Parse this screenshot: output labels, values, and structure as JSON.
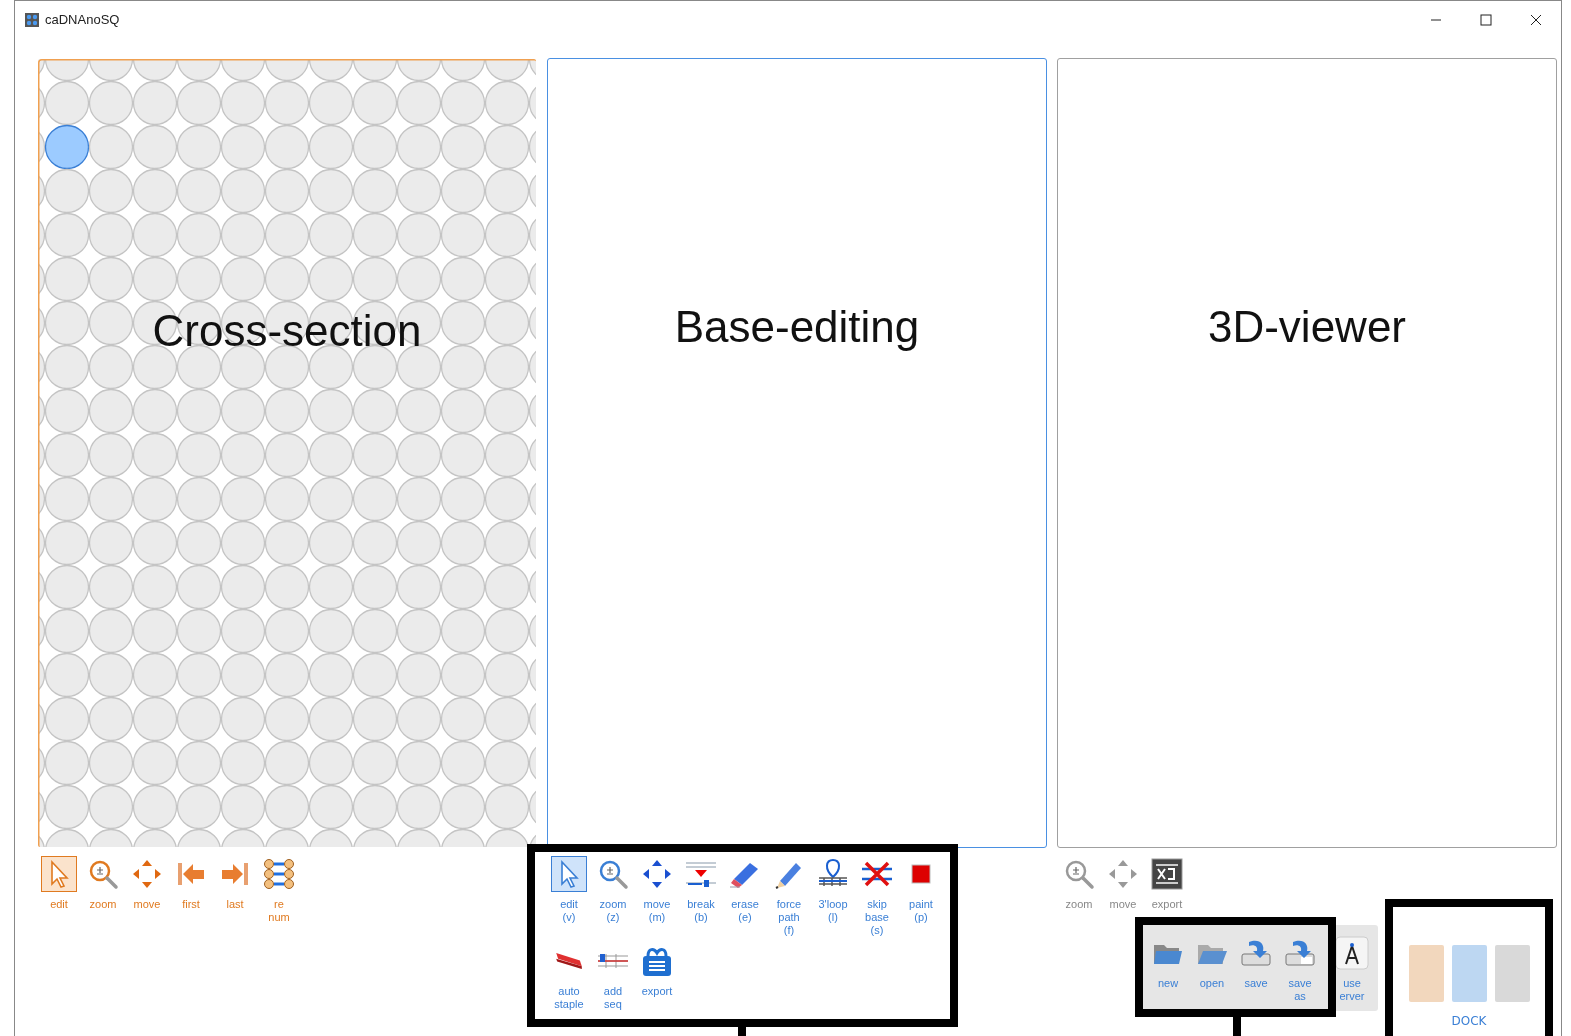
{
  "window": {
    "title": "caDNAnoSQ"
  },
  "panels": [
    {
      "label": "Cross-section",
      "color": "#f0a050",
      "kind": "lattice",
      "tools": [
        {
          "lines": [
            "edit"
          ],
          "selected": true
        },
        {
          "lines": [
            "zoom"
          ],
          "selected": false
        },
        {
          "lines": [
            "move"
          ],
          "selected": false
        },
        {
          "lines": [
            "first"
          ],
          "selected": false
        },
        {
          "lines": [
            "last"
          ],
          "selected": false
        },
        {
          "lines": [
            "re",
            "num"
          ],
          "selected": false
        }
      ]
    },
    {
      "label": "Base-editing",
      "color": "#4a90e2",
      "kind": "blank",
      "tools": [
        {
          "lines": [
            "edit",
            "(v)"
          ],
          "selected": true
        },
        {
          "lines": [
            "zoom",
            "(z)"
          ],
          "selected": false
        },
        {
          "lines": [
            "move",
            "(m)"
          ],
          "selected": false
        },
        {
          "lines": [
            "break",
            "(b)"
          ],
          "selected": false
        },
        {
          "lines": [
            "erase",
            "(e)"
          ],
          "selected": false
        },
        {
          "lines": [
            "force",
            "path",
            "(f)"
          ],
          "selected": false
        },
        {
          "lines": [
            "3'loop",
            "(l)"
          ],
          "selected": false
        },
        {
          "lines": [
            "skip",
            "base",
            "(s)"
          ],
          "selected": false
        },
        {
          "lines": [
            "paint",
            "(p)"
          ],
          "selected": false
        },
        {
          "lines": [
            "auto",
            "staple"
          ],
          "selected": false
        },
        {
          "lines": [
            "add",
            "seq"
          ],
          "selected": false
        },
        {
          "lines": [
            "export"
          ],
          "selected": false
        }
      ]
    },
    {
      "label": "3D-viewer",
      "color": "#a0a0a0",
      "kind": "blank",
      "tools": [
        {
          "lines": [
            "zoom"
          ],
          "selected": false
        },
        {
          "lines": [
            "move"
          ],
          "selected": false
        },
        {
          "lines": [
            "export"
          ],
          "selected": false
        }
      ]
    }
  ],
  "file_tools": [
    {
      "lines": [
        "new"
      ]
    },
    {
      "lines": [
        "open"
      ]
    },
    {
      "lines": [
        "save"
      ]
    },
    {
      "lines": [
        "save",
        "as"
      ]
    },
    {
      "lines": [
        "use",
        "erver"
      ]
    }
  ],
  "dock": {
    "label": "DOCK",
    "swatches": [
      {
        "color": "#f2d7bd"
      },
      {
        "color": "#bdd7f2"
      },
      {
        "color": "#d9d9d9"
      }
    ]
  }
}
